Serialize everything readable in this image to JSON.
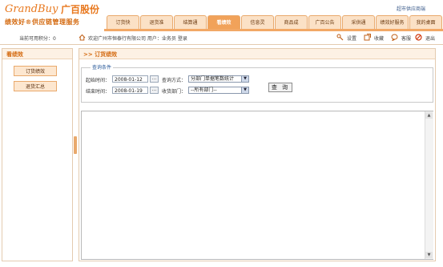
{
  "header": {
    "logo_en": "GrandBuy",
    "logo_cn": "广百股份",
    "slogan": "绩效好®供应链管理服务",
    "top_link": "超市供应商端",
    "tabs": [
      "订货快",
      "退货准",
      "结算通",
      "看绩效",
      "信息灵",
      "商品成",
      "广百公告",
      "采供通",
      "绩效好服务",
      "我的桌面"
    ],
    "active_tab": "看绩效"
  },
  "infobar": {
    "points_label": "当前可用积分：0",
    "welcome": "欢迎广州市恒泰行有限公司 用户：业务员 登录",
    "tools": [
      "设置",
      "收藏",
      "客服",
      "退出"
    ]
  },
  "sidebar": {
    "title": "看绩效",
    "items": [
      "订货绩效",
      "退货汇总"
    ]
  },
  "main": {
    "title": ">> 订货绩效",
    "legend": "查询条件",
    "start_label": "起始时间：",
    "start_value": "2008-01-12",
    "end_label": "结束时间：",
    "end_value": "2008-01-19",
    "dots": "...",
    "mode_label": "查询方式：",
    "mode_value": "分部门单据笔数统计",
    "dept_label": "收货部门：",
    "dept_value": "--所有部门--",
    "query_button": "查 询"
  },
  "colors": {
    "accent": "#e8781e",
    "tab_bg": "#fbe1c6",
    "tab_active": "#f1a25a",
    "panel_head": "#fdf1e4"
  }
}
